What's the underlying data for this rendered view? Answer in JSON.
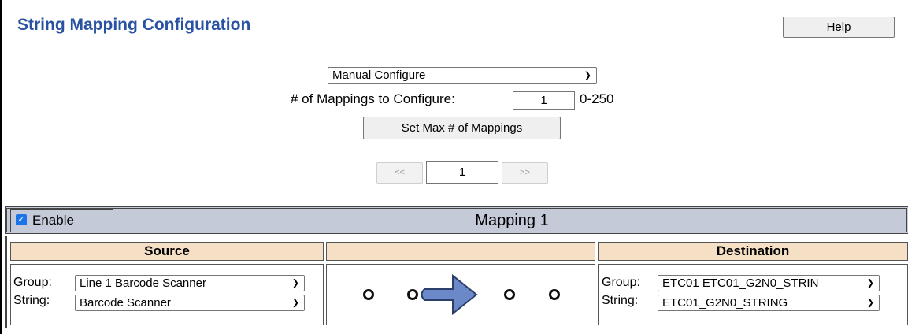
{
  "header": {
    "title": "String Mapping Configuration",
    "help_label": "Help"
  },
  "config": {
    "mode_select": "Manual Configure",
    "mappings_label": "# of Mappings to Configure:",
    "mappings_value": "1",
    "range_label": "0-250",
    "set_max_label": "Set Max # of Mappings"
  },
  "pager": {
    "prev_label": "<<",
    "page_value": "1",
    "next_label": ">>"
  },
  "mapping": {
    "enable_label": "Enable",
    "enable_checked": true,
    "title": "Mapping 1",
    "source": {
      "heading": "Source",
      "group_label": "Group:",
      "group_value": "Line 1 Barcode Scanner",
      "string_label": "String:",
      "string_value": "Barcode Scanner"
    },
    "destination": {
      "heading": "Destination",
      "group_label": "Group:",
      "group_value": "ETC01 ETC01_G2N0_STRIN",
      "string_label": "String:",
      "string_value": "ETC01_G2N0_STRING"
    },
    "arrow_icon": "arrow-right-icon",
    "arrow_color": "#6b88c8"
  }
}
